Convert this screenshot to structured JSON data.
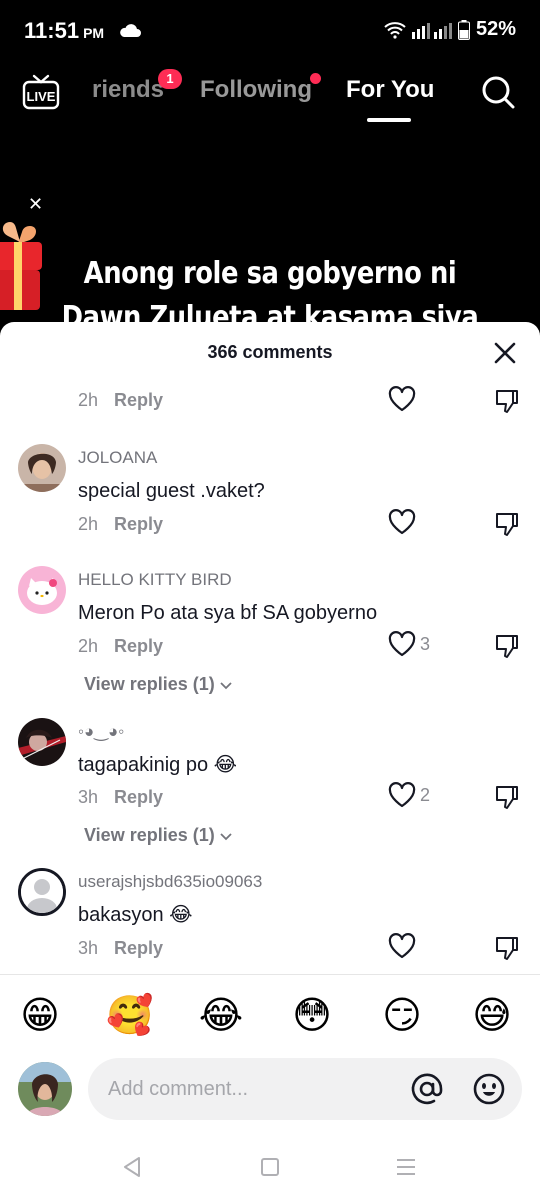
{
  "status": {
    "time": "11:51",
    "ampm": "PM",
    "battery": "52%"
  },
  "nav": {
    "live_label": "LIVE",
    "tabs": [
      {
        "label": "riends",
        "badge": "1"
      },
      {
        "label": "Following"
      },
      {
        "label": "For You"
      }
    ]
  },
  "video": {
    "caption_line1": "Anong role sa gobyerno ni",
    "caption_line2": "Dawn Zulueta at kasama siya"
  },
  "comments_sheet": {
    "title": "366 comments",
    "reply_label": "Reply",
    "top_partial": {
      "time": "2h"
    },
    "comments": [
      {
        "username": "JOLOANA",
        "text": "special guest .vaket?",
        "time": "2h",
        "likes": "",
        "view_replies": ""
      },
      {
        "username": "HELLO KITTY BIRD",
        "text": "Meron Po ata sya bf SA gobyerno",
        "time": "2h",
        "likes": "3",
        "view_replies": "View replies (1)"
      },
      {
        "username": "◦◕‿◕◦",
        "text": "tagapakinig po 😂",
        "time": "3h",
        "likes": "2",
        "view_replies": "View replies (1)"
      },
      {
        "username": "userajshjsbd635io09063",
        "text": "bakasyon 😂",
        "time": "3h",
        "likes": "",
        "view_replies": ""
      }
    ]
  },
  "emoji_bar": [
    "😁",
    "🥰",
    "😂",
    "😳",
    "😏",
    "😅"
  ],
  "comment_input": {
    "placeholder": "Add comment..."
  },
  "colors": {
    "accent": "#fe2c55",
    "text_primary": "#161823",
    "text_secondary": "#8a8b91"
  }
}
